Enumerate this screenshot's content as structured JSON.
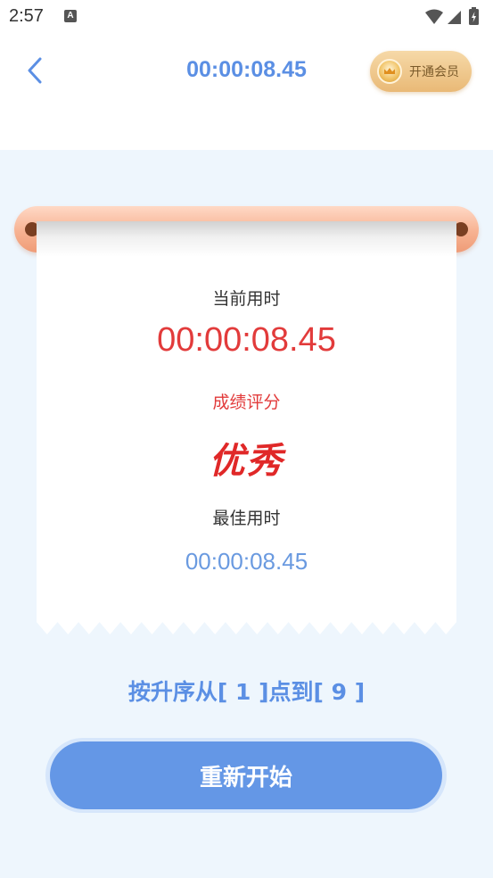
{
  "status_bar": {
    "time": "2:57",
    "icons": [
      "a-notification-icon",
      "wifi-icon",
      "signal-icon",
      "battery-charging-icon"
    ]
  },
  "header": {
    "back_icon": "chevron-left-icon",
    "elapsed_time": "00:00:08.45",
    "vip_label": "开通会员",
    "vip_icon": "vip-crown-icon"
  },
  "result": {
    "current_label": "当前用时",
    "current_time": "00:00:08.45",
    "score_label": "成绩评分",
    "score_value": "优秀",
    "best_label": "最佳用时",
    "best_time": "00:00:08.45"
  },
  "instruction": "按升序从[ 1 ]点到[ 9 ]",
  "restart_label": "重新开始",
  "colors": {
    "accent_blue": "#5b8fe4",
    "button_blue": "#6497e6",
    "result_red": "#e23b3b",
    "background": "#eef6fd",
    "roller": "#f7b292"
  }
}
